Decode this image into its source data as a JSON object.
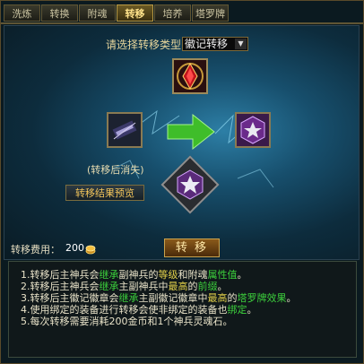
{
  "tabs": [
    "洗炼",
    "转换",
    "附魂",
    "转移",
    "培养",
    "塔罗牌"
  ],
  "active_tab": "转移",
  "type_selector": {
    "label": "请选择转移类型",
    "selected": "徽记转移"
  },
  "disappear_note": "(转移后消失)",
  "preview_button": "转移结果预览",
  "cost": {
    "label": "转移费用：",
    "value": "200"
  },
  "transfer_button": "转 移",
  "icons": {
    "top_slot": "red-gem-emblem-icon",
    "left_slot": "sword-scroll-icon",
    "right_slot": "silver-star-emblem-icon",
    "bottom_slot": "silver-star-emblem-icon",
    "arrow": "green-arrow-icon",
    "gold": "gold-coin-icon"
  },
  "info_lines": [
    [
      {
        "t": "1.转移后主神兵会"
      },
      {
        "t": "继承",
        "c": "g"
      },
      {
        "t": "副神兵的"
      },
      {
        "t": "等级",
        "c": "y"
      },
      {
        "t": "和附魂"
      },
      {
        "t": "属性值",
        "c": "g"
      },
      {
        "t": "。"
      }
    ],
    [
      {
        "t": "2.转移后主神兵会"
      },
      {
        "t": "继承",
        "c": "g"
      },
      {
        "t": "主副神兵中"
      },
      {
        "t": "最高",
        "c": "y"
      },
      {
        "t": "的"
      },
      {
        "t": "前缀",
        "c": "g"
      },
      {
        "t": "。"
      }
    ],
    [
      {
        "t": "3.转移后主徽记徽章会"
      },
      {
        "t": "继承",
        "c": "g"
      },
      {
        "t": "主副徽记徽章中"
      },
      {
        "t": "最高",
        "c": "y"
      },
      {
        "t": "的"
      },
      {
        "t": "塔罗牌效果",
        "c": "g"
      },
      {
        "t": "。"
      }
    ],
    [
      {
        "t": "4.使用绑定的装备进行转移会使非绑定的装备也"
      },
      {
        "t": "绑定",
        "c": "g"
      },
      {
        "t": "。"
      }
    ],
    [
      {
        "t": "5.每次转移需要消耗200金币和1个神兵灵魂石。"
      }
    ]
  ]
}
